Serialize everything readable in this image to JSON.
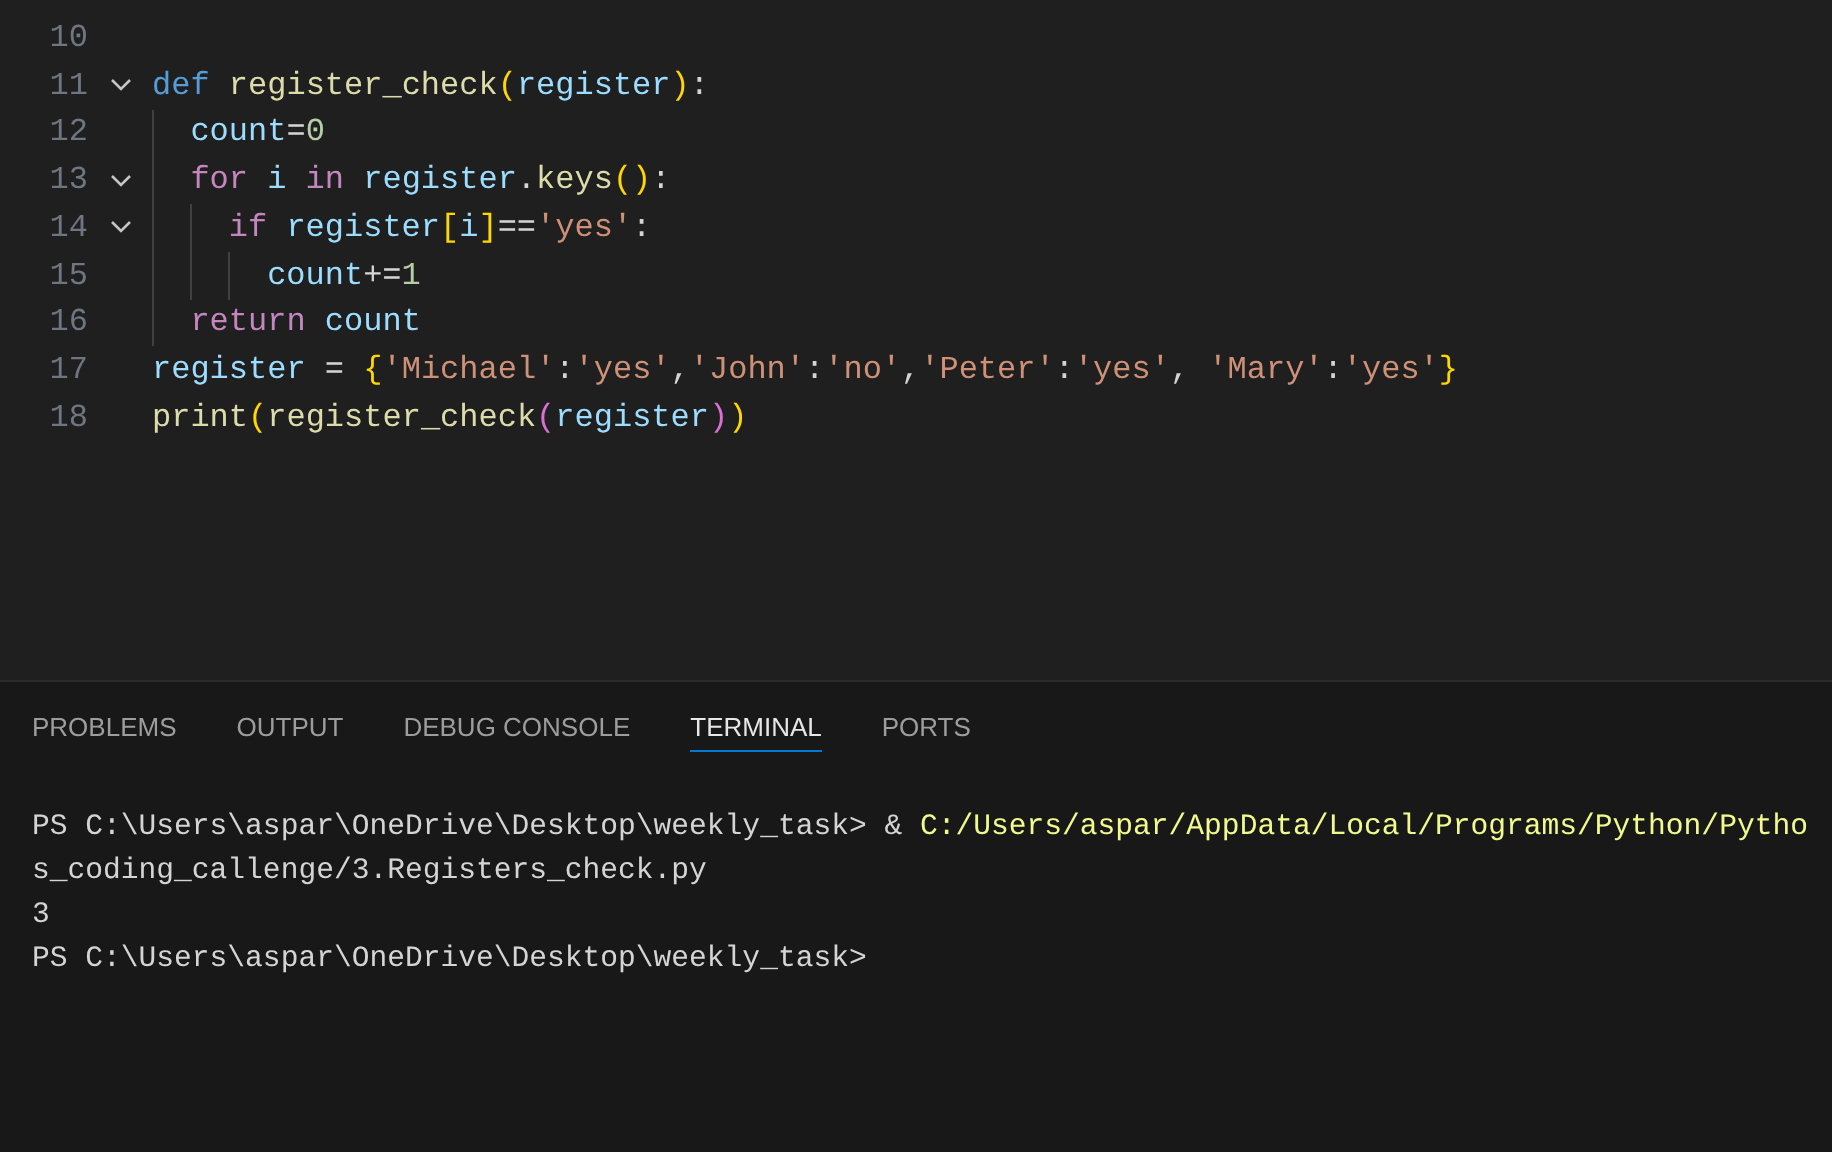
{
  "editor": {
    "lines": [
      {
        "number": "10"
      },
      {
        "number": "11",
        "fold": true,
        "tokens": [
          {
            "kind": "storage",
            "text": "def "
          },
          {
            "kind": "function",
            "text": "register_check"
          },
          {
            "kind": "bracket1",
            "text": "("
          },
          {
            "kind": "variable",
            "text": "register"
          },
          {
            "kind": "bracket1",
            "text": ")"
          },
          {
            "kind": "plain",
            "text": ":"
          }
        ],
        "children": [
          {
            "number": "12",
            "tokens": [
              {
                "kind": "variable",
                "text": "count"
              },
              {
                "kind": "plain",
                "text": "="
              },
              {
                "kind": "number",
                "text": "0"
              }
            ]
          },
          {
            "number": "13",
            "fold": true,
            "tokens": [
              {
                "kind": "control",
                "text": "for "
              },
              {
                "kind": "variable",
                "text": "i "
              },
              {
                "kind": "control",
                "text": "in "
              },
              {
                "kind": "variable",
                "text": "register"
              },
              {
                "kind": "plain",
                "text": "."
              },
              {
                "kind": "function",
                "text": "keys"
              },
              {
                "kind": "bracket1",
                "text": "()"
              },
              {
                "kind": "plain",
                "text": ":"
              }
            ],
            "children": [
              {
                "number": "14",
                "fold": true,
                "tokens": [
                  {
                    "kind": "control",
                    "text": "if "
                  },
                  {
                    "kind": "variable",
                    "text": "register"
                  },
                  {
                    "kind": "bracket1",
                    "text": "["
                  },
                  {
                    "kind": "variable",
                    "text": "i"
                  },
                  {
                    "kind": "bracket1",
                    "text": "]"
                  },
                  {
                    "kind": "plain",
                    "text": "=="
                  },
                  {
                    "kind": "string",
                    "text": "'yes'"
                  },
                  {
                    "kind": "plain",
                    "text": ":"
                  }
                ],
                "children": [
                  {
                    "number": "15",
                    "tokens": [
                      {
                        "kind": "variable",
                        "text": "count"
                      },
                      {
                        "kind": "plain",
                        "text": "+="
                      },
                      {
                        "kind": "number",
                        "text": "1"
                      }
                    ]
                  }
                ]
              }
            ]
          },
          {
            "number": "16",
            "tokens": [
              {
                "kind": "control",
                "text": "return "
              },
              {
                "kind": "variable",
                "text": "count"
              }
            ]
          }
        ]
      },
      {
        "number": "17",
        "tokens": [
          {
            "kind": "variable",
            "text": "register"
          },
          {
            "kind": "plain",
            "text": " = "
          },
          {
            "kind": "bracket1",
            "text": "{"
          },
          {
            "kind": "string",
            "text": "'Michael'"
          },
          {
            "kind": "plain",
            "text": ":"
          },
          {
            "kind": "string",
            "text": "'yes'"
          },
          {
            "kind": "plain",
            "text": ","
          },
          {
            "kind": "string",
            "text": "'John'"
          },
          {
            "kind": "plain",
            "text": ":"
          },
          {
            "kind": "string",
            "text": "'no'"
          },
          {
            "kind": "plain",
            "text": ","
          },
          {
            "kind": "string",
            "text": "'Peter'"
          },
          {
            "kind": "plain",
            "text": ":"
          },
          {
            "kind": "string",
            "text": "'yes'"
          },
          {
            "kind": "plain",
            "text": ", "
          },
          {
            "kind": "string",
            "text": "'Mary'"
          },
          {
            "kind": "plain",
            "text": ":"
          },
          {
            "kind": "string",
            "text": "'yes'"
          },
          {
            "kind": "bracket1",
            "text": "}"
          }
        ]
      },
      {
        "number": "18",
        "tokens": [
          {
            "kind": "function",
            "text": "print"
          },
          {
            "kind": "bracket1",
            "text": "("
          },
          {
            "kind": "function",
            "text": "register_check"
          },
          {
            "kind": "bracket2",
            "text": "("
          },
          {
            "kind": "variable",
            "text": "register"
          },
          {
            "kind": "bracket2",
            "text": ")"
          },
          {
            "kind": "bracket1",
            "text": ")"
          }
        ]
      }
    ]
  },
  "panel": {
    "tabs": [
      {
        "label": "PROBLEMS",
        "selected": false
      },
      {
        "label": "OUTPUT",
        "selected": false
      },
      {
        "label": "DEBUG CONSOLE",
        "selected": false
      },
      {
        "label": "TERMINAL",
        "selected": true
      },
      {
        "label": "PORTS",
        "selected": false
      }
    ],
    "terminal": [
      [
        {
          "kind": "plain",
          "text": "PS C:\\Users\\aspar\\OneDrive\\Desktop\\weekly_task> & "
        },
        {
          "kind": "command",
          "text": "C:/Users/aspar/AppData/Local/Programs/Python/Pytho"
        }
      ],
      [
        {
          "kind": "plain",
          "text": "s_coding_callenge/3.Registers_check.py"
        }
      ],
      [
        {
          "kind": "plain",
          "text": "3"
        }
      ],
      [
        {
          "kind": "plain",
          "text": "PS C:\\Users\\aspar\\OneDrive\\Desktop\\weekly_task>"
        }
      ]
    ]
  }
}
